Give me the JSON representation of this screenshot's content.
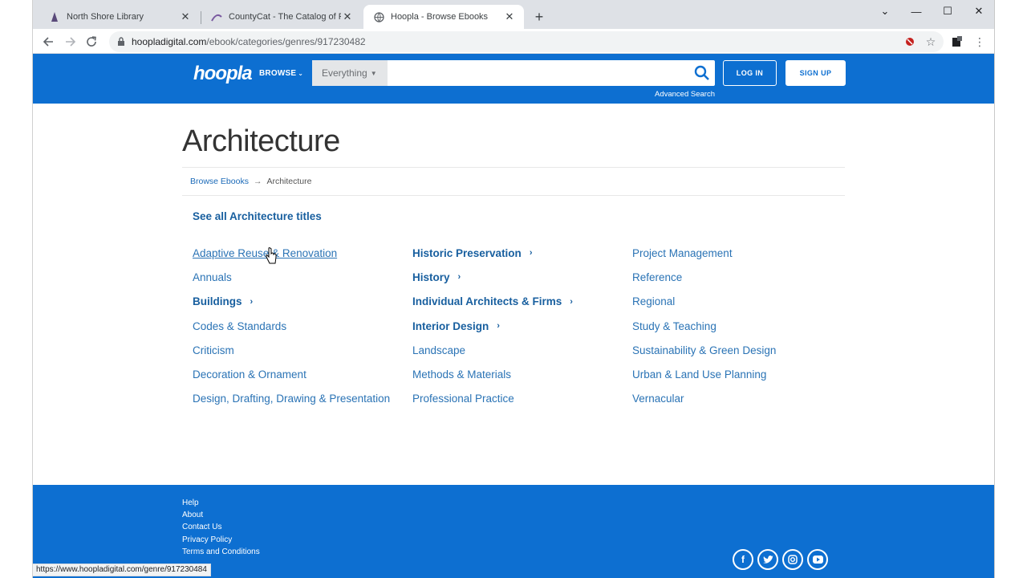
{
  "browser": {
    "tabs": [
      {
        "title": "North Shore Library",
        "active": false
      },
      {
        "title": "CountyCat - The Catalog of Publi",
        "active": false
      },
      {
        "title": "Hoopla - Browse Ebooks",
        "active": true
      }
    ],
    "url_host": "hoopladigital.com",
    "url_path": "/ebook/categories/genres/917230482",
    "status_url": "https://www.hoopladigital.com/genre/917230484"
  },
  "header": {
    "logo": "hoopla",
    "browse_label": "BROWSE",
    "search_scope": "Everything",
    "search_placeholder": "",
    "advanced_search": "Advanced Search",
    "login_label": "LOG IN",
    "signup_label": "SIGN UP",
    "accent_color": "#0d6fd1"
  },
  "main": {
    "title": "Architecture",
    "breadcrumb": {
      "parent": "Browse Ebooks",
      "current": "Architecture"
    },
    "see_all": "See all Architecture titles",
    "genres": [
      [
        {
          "label": "Adaptive Reuse & Renovation",
          "has_children": false
        },
        {
          "label": "Annuals",
          "has_children": false
        },
        {
          "label": "Buildings",
          "has_children": true
        },
        {
          "label": "Codes & Standards",
          "has_children": false
        },
        {
          "label": "Criticism",
          "has_children": false
        },
        {
          "label": "Decoration & Ornament",
          "has_children": false
        },
        {
          "label": "Design, Drafting, Drawing & Presentation",
          "has_children": false
        }
      ],
      [
        {
          "label": "Historic Preservation",
          "has_children": true
        },
        {
          "label": "History",
          "has_children": true
        },
        {
          "label": "Individual Architects & Firms",
          "has_children": true
        },
        {
          "label": "Interior Design",
          "has_children": true
        },
        {
          "label": "Landscape",
          "has_children": false
        },
        {
          "label": "Methods & Materials",
          "has_children": false
        },
        {
          "label": "Professional Practice",
          "has_children": false
        }
      ],
      [
        {
          "label": "Project Management",
          "has_children": false
        },
        {
          "label": "Reference",
          "has_children": false
        },
        {
          "label": "Regional",
          "has_children": false
        },
        {
          "label": "Study & Teaching",
          "has_children": false
        },
        {
          "label": "Sustainability & Green Design",
          "has_children": false
        },
        {
          "label": "Urban & Land Use Planning",
          "has_children": false
        },
        {
          "label": "Vernacular",
          "has_children": false
        }
      ]
    ]
  },
  "footer": {
    "links": [
      "Help",
      "About",
      "Contact Us",
      "Privacy Policy",
      "Terms and Conditions"
    ],
    "social": [
      "facebook-icon",
      "twitter-icon",
      "instagram-icon",
      "youtube-icon"
    ]
  }
}
